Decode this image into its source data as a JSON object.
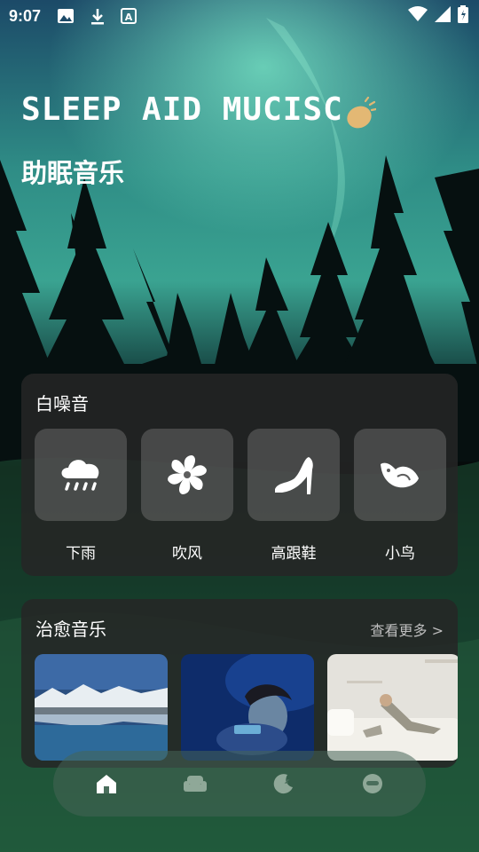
{
  "status_bar": {
    "time": "9:07"
  },
  "header": {
    "title": "SLEEP AID MUCISC",
    "subtitle": "助眠音乐"
  },
  "white_noise": {
    "heading": "白噪音",
    "items": [
      {
        "label": "下雨",
        "icon": "rain-cloud-icon"
      },
      {
        "label": "吹风",
        "icon": "fan-icon"
      },
      {
        "label": "高跟鞋",
        "icon": "high-heel-icon"
      },
      {
        "label": "小鸟",
        "icon": "bird-icon"
      }
    ]
  },
  "healing_music": {
    "heading": "治愈音乐",
    "more_label": "查看更多 >",
    "thumbnails": [
      "mountain-lake-image",
      "woman-sleeping-image",
      "man-on-sofa-image"
    ]
  },
  "bottom_nav": {
    "items": [
      "home-icon",
      "sofa-icon",
      "moon-icon",
      "face-icon"
    ],
    "active": "home-icon"
  },
  "colors": {
    "aurora": "#4fd2b4",
    "card": "#262626",
    "tile": "#5e5e5e"
  }
}
